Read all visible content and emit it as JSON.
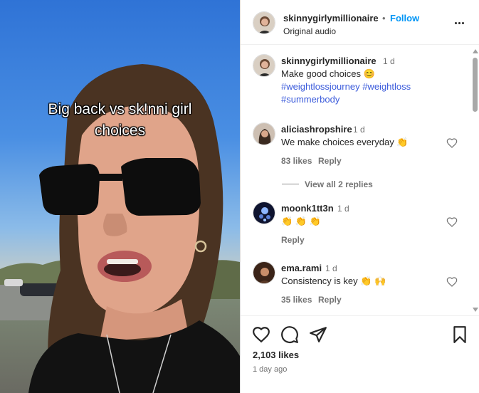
{
  "video": {
    "caption_line1": "Big back vs sk!nni girl",
    "caption_line2": "choices"
  },
  "header": {
    "username": "skinnygirlymillionaire",
    "separator": "•",
    "follow_label": "Follow",
    "audio": "Original audio",
    "more_icon": "more-horizontal-icon"
  },
  "caption": {
    "username": "skinnygirlymillionaire",
    "time": "1 d",
    "text": "Make good choices 😊",
    "hashtags": [
      "#weightlossjourney",
      "#weightloss",
      "#summerbody"
    ]
  },
  "comments": [
    {
      "username": "aliciashropshire",
      "time": "1 d",
      "text": "We make choices everyday 👏",
      "likes": "83 likes",
      "reply_label": "Reply",
      "view_replies": "View all 2 replies"
    },
    {
      "username": "moonk1tt3n",
      "time": "1 d",
      "text": "👏 👏 👏",
      "reply_label": "Reply"
    },
    {
      "username": "ema.rami",
      "time": "1 d",
      "text": "Consistency is key 👏 🙌",
      "likes": "35 likes",
      "reply_label": "Reply"
    }
  ],
  "actions": {
    "likes": "2,103 likes",
    "posted": "1 day ago"
  },
  "colors": {
    "link_blue": "#0095f6",
    "hashtag": "#3b5bdb",
    "muted": "#737373"
  }
}
